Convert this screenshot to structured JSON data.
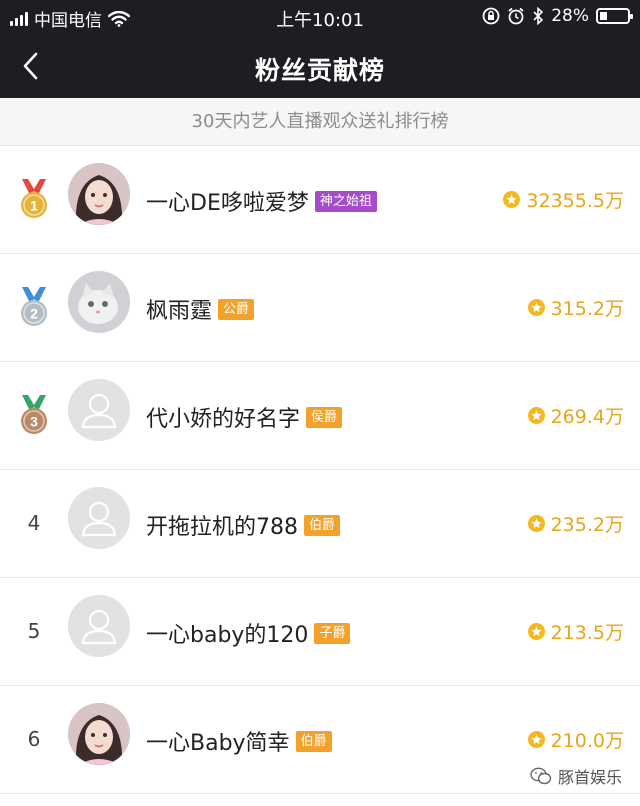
{
  "status_bar": {
    "carrier": "中国电信",
    "time": "上午10:01",
    "battery_percent": "28%",
    "battery_level": 0.28,
    "icons": [
      "signal-icon",
      "wifi-icon",
      "orientation-lock-icon",
      "alarm-icon",
      "bluetooth-icon",
      "battery-icon"
    ]
  },
  "nav": {
    "title": "粉丝贡献榜",
    "back_icon": "chevron-left-icon"
  },
  "subtitle": "30天内艺人直播观众送礼排行榜",
  "colors": {
    "header_bg": "#1d1d24",
    "score_text": "#e8a51a",
    "badge_orange": "#f2a12b",
    "badge_purple": "#a64bc9",
    "medal_gold": "#e4b53a",
    "medal_silver": "#b4bcc6",
    "medal_bronze": "#b98866",
    "ribbon_red": "#e2483b",
    "ribbon_blue": "#3d8fd8",
    "ribbon_green": "#35a46a"
  },
  "rows": [
    {
      "rank": "1",
      "medal": "gold",
      "avatar": "photo",
      "name": "一心DE哆啦爱梦",
      "badge": "神之始祖",
      "badge_color": "#a64bc9",
      "score": "32355.5万"
    },
    {
      "rank": "2",
      "medal": "silver",
      "avatar": "cat-photo",
      "name": "枫雨霆",
      "badge": "公爵",
      "badge_color": "#f2a12b",
      "score": "315.2万"
    },
    {
      "rank": "3",
      "medal": "bronze",
      "avatar": "default",
      "name": "代小娇的好名字",
      "badge": "侯爵",
      "badge_color": "#f2a12b",
      "score": "269.4万"
    },
    {
      "rank": "4",
      "medal": "",
      "avatar": "default",
      "name": "开拖拉机的788",
      "badge": "伯爵",
      "badge_color": "#f2a12b",
      "score": "235.2万"
    },
    {
      "rank": "5",
      "medal": "",
      "avatar": "default",
      "name": "一心baby的120",
      "badge": "子爵",
      "badge_color": "#f2a12b",
      "score": "213.5万"
    },
    {
      "rank": "6",
      "medal": "",
      "avatar": "photo",
      "name": "一心Baby简幸",
      "badge": "伯爵",
      "badge_color": "#f2a12b",
      "score": "210.0万"
    }
  ],
  "watermark": {
    "text": "豚首娱乐",
    "icon": "wechat-icon"
  }
}
